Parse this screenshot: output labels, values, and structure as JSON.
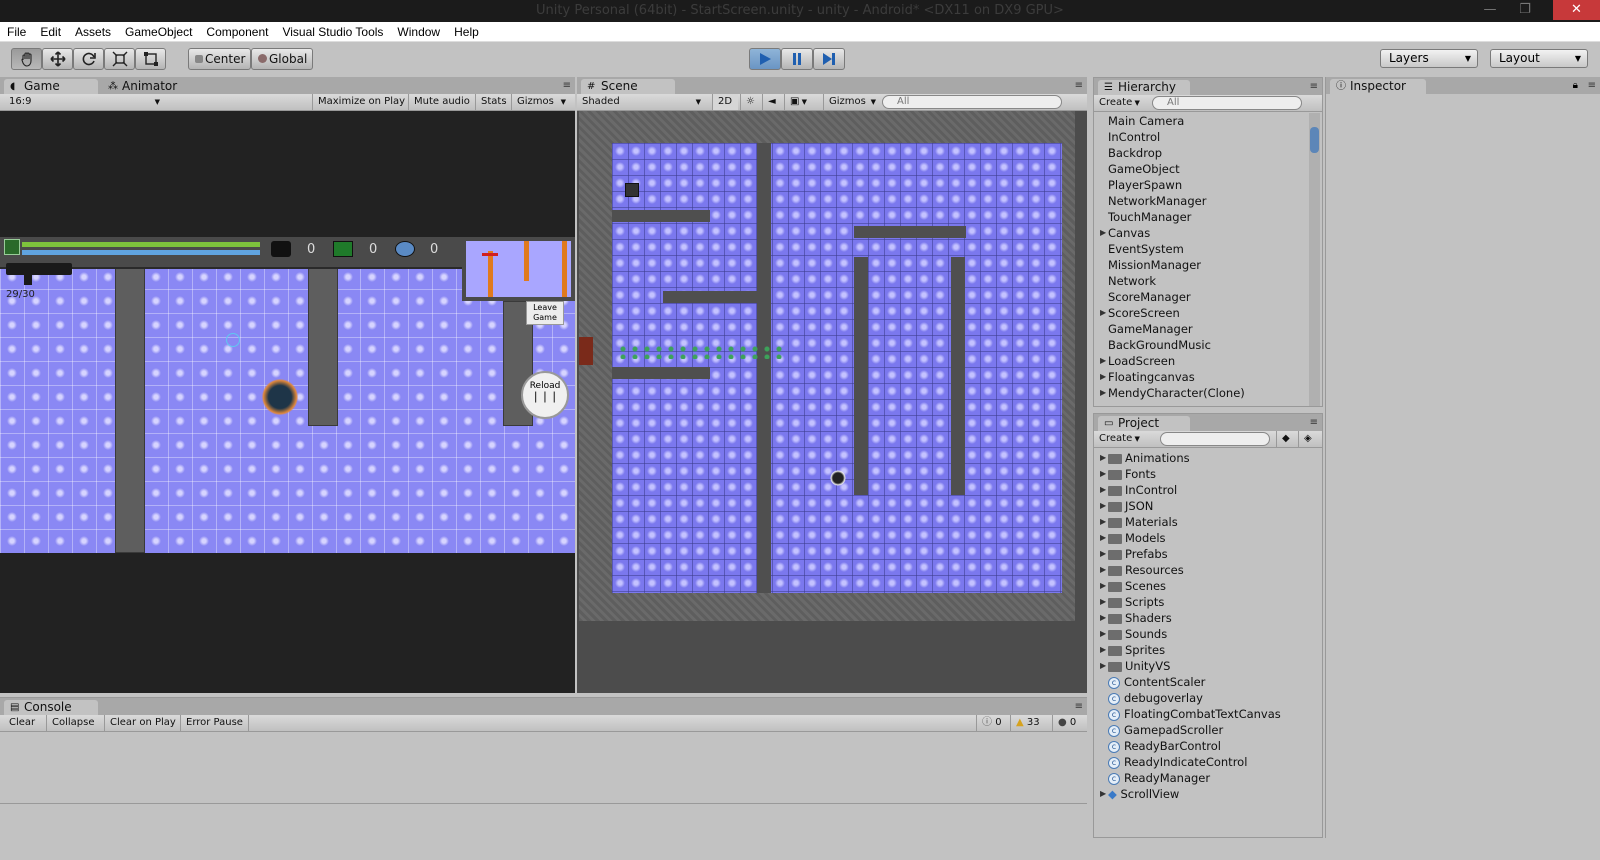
{
  "window": {
    "title": "Unity Personal (64bit) - StartScreen.unity - unity - Android* <DX11 on DX9 GPU>",
    "minimize": "—",
    "maximize": "❐",
    "close": "✕"
  },
  "menu": [
    "File",
    "Edit",
    "Assets",
    "GameObject",
    "Component",
    "Visual Studio Tools",
    "Window",
    "Help"
  ],
  "toolbar": {
    "tools": [
      "hand-tool",
      "move-tool",
      "rotate-tool",
      "scale-tool",
      "rect-tool"
    ],
    "pivot": "Center",
    "space": "Global",
    "layers": "Layers",
    "layout": "Layout"
  },
  "game": {
    "tab": "Game",
    "tab2": "Animator",
    "aspect": "16:9",
    "buttons": [
      "Maximize on Play",
      "Mute audio",
      "Stats",
      "Gizmos"
    ],
    "ammo": "29/30",
    "hud_counts": [
      "0",
      "0",
      "0"
    ],
    "leave": "Leave Game",
    "reload": "Reload"
  },
  "scene": {
    "tab": "Scene",
    "shading": "Shaded",
    "mode2d": "2D",
    "gizmos": "Gizmos",
    "search": "All"
  },
  "hierarchy": {
    "tab": "Hierarchy",
    "create": "Create",
    "search": "All",
    "items": [
      {
        "label": "Main Camera",
        "expand": false
      },
      {
        "label": "InControl",
        "expand": false
      },
      {
        "label": "Backdrop",
        "expand": false
      },
      {
        "label": "GameObject",
        "expand": false
      },
      {
        "label": "PlayerSpawn",
        "expand": false
      },
      {
        "label": "NetworkManager",
        "expand": false
      },
      {
        "label": "TouchManager",
        "expand": false
      },
      {
        "label": "Canvas",
        "expand": true
      },
      {
        "label": "EventSystem",
        "expand": false
      },
      {
        "label": "MissionManager",
        "expand": false
      },
      {
        "label": "Network",
        "expand": false
      },
      {
        "label": "ScoreManager",
        "expand": false
      },
      {
        "label": "ScoreScreen",
        "expand": true
      },
      {
        "label": "GameManager",
        "expand": false
      },
      {
        "label": "BackGroundMusic",
        "expand": false
      },
      {
        "label": "LoadScreen",
        "expand": true
      },
      {
        "label": "Floatingcanvas",
        "expand": true
      },
      {
        "label": "MendyCharacter(Clone)",
        "expand": true
      }
    ]
  },
  "inspector": {
    "tab": "Inspector"
  },
  "project": {
    "tab": "Project",
    "create": "Create",
    "folders": [
      "Animations",
      "Fonts",
      "InControl",
      "JSON",
      "Materials",
      "Models",
      "Prefabs",
      "Resources",
      "Scenes",
      "Scripts",
      "Shaders",
      "Sounds",
      "Sprites",
      "UnityVS"
    ],
    "scripts": [
      "ContentScaler",
      "debugoverlay",
      "FloatingCombatTextCanvas",
      "GamepadScroller",
      "ReadyBarControl",
      "ReadyIndicateControl",
      "ReadyManager"
    ],
    "prefab": "ScrollView"
  },
  "console": {
    "tab": "Console",
    "buttons": [
      "Clear",
      "Collapse",
      "Clear on Play",
      "Error Pause"
    ],
    "info_count": "0",
    "warn_count": "33",
    "error_count": "0"
  }
}
